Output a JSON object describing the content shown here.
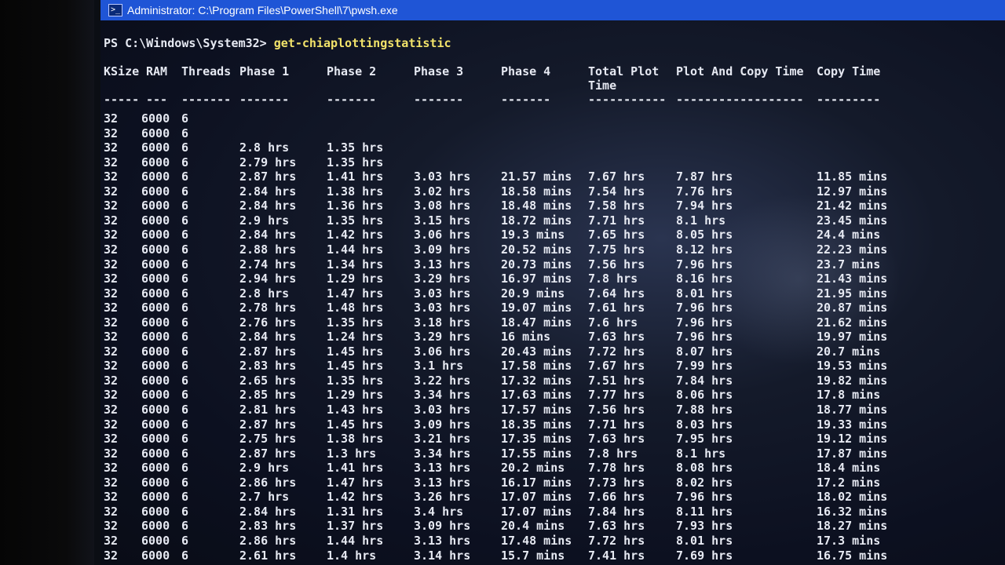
{
  "window": {
    "title": "Administrator: C:\\Program Files\\PowerShell\\7\\pwsh.exe",
    "icon": "powershell-icon"
  },
  "prompt": {
    "path": "PS C:\\Windows\\System32> ",
    "command": "get-chiaplottingstatistic"
  },
  "headers": {
    "ksize": "KSize",
    "ram": "RAM",
    "threads": "Threads",
    "phase1": "Phase 1",
    "phase2": "Phase 2",
    "phase3": "Phase 3",
    "phase4": "Phase 4",
    "total_line1": "Total Plot",
    "total_line2": "Time",
    "plot_and_copy": "Plot And Copy Time",
    "copy": "Copy Time"
  },
  "dashes": {
    "ksize": "-----",
    "ram": "---",
    "threads": "-------",
    "phase1": "-------",
    "phase2": "-------",
    "phase3": "-------",
    "phase4": "-------",
    "total": "-----------",
    "plot_and_copy": "------------------",
    "copy": "---------"
  },
  "rows": [
    [
      "32",
      "6000",
      "6",
      "",
      "",
      "",
      "",
      "",
      "",
      ""
    ],
    [
      "32",
      "6000",
      "6",
      "",
      "",
      "",
      "",
      "",
      "",
      ""
    ],
    [
      "32",
      "6000",
      "6",
      "2.8 hrs",
      "1.35 hrs",
      "",
      "",
      "",
      "",
      ""
    ],
    [
      "32",
      "6000",
      "6",
      "2.79 hrs",
      "1.35 hrs",
      "",
      "",
      "",
      "",
      ""
    ],
    [
      "32",
      "6000",
      "6",
      "2.87 hrs",
      "1.41 hrs",
      "3.03 hrs",
      "21.57 mins",
      "7.67 hrs",
      "7.87 hrs",
      "11.85 mins"
    ],
    [
      "32",
      "6000",
      "6",
      "2.84 hrs",
      "1.38 hrs",
      "3.02 hrs",
      "18.58 mins",
      "7.54 hrs",
      "7.76 hrs",
      "12.97 mins"
    ],
    [
      "32",
      "6000",
      "6",
      "2.84 hrs",
      "1.36 hrs",
      "3.08 hrs",
      "18.48 mins",
      "7.58 hrs",
      "7.94 hrs",
      "21.42 mins"
    ],
    [
      "32",
      "6000",
      "6",
      "2.9 hrs",
      "1.35 hrs",
      "3.15 hrs",
      "18.72 mins",
      "7.71 hrs",
      "8.1 hrs",
      "23.45 mins"
    ],
    [
      "32",
      "6000",
      "6",
      "2.84 hrs",
      "1.42 hrs",
      "3.06 hrs",
      "19.3 mins",
      "7.65 hrs",
      "8.05 hrs",
      "24.4 mins"
    ],
    [
      "32",
      "6000",
      "6",
      "2.88 hrs",
      "1.44 hrs",
      "3.09 hrs",
      "20.52 mins",
      "7.75 hrs",
      "8.12 hrs",
      "22.23 mins"
    ],
    [
      "32",
      "6000",
      "6",
      "2.74 hrs",
      "1.34 hrs",
      "3.13 hrs",
      "20.73 mins",
      "7.56 hrs",
      "7.96 hrs",
      "23.7 mins"
    ],
    [
      "32",
      "6000",
      "6",
      "2.94 hrs",
      "1.29 hrs",
      "3.29 hrs",
      "16.97 mins",
      "7.8 hrs",
      "8.16 hrs",
      "21.43 mins"
    ],
    [
      "32",
      "6000",
      "6",
      "2.8 hrs",
      "1.47 hrs",
      "3.03 hrs",
      "20.9 mins",
      "7.64 hrs",
      "8.01 hrs",
      "21.95 mins"
    ],
    [
      "32",
      "6000",
      "6",
      "2.78 hrs",
      "1.48 hrs",
      "3.03 hrs",
      "19.07 mins",
      "7.61 hrs",
      "7.96 hrs",
      "20.87 mins"
    ],
    [
      "32",
      "6000",
      "6",
      "2.76 hrs",
      "1.35 hrs",
      "3.18 hrs",
      "18.47 mins",
      "7.6 hrs",
      "7.96 hrs",
      "21.62 mins"
    ],
    [
      "32",
      "6000",
      "6",
      "2.84 hrs",
      "1.24 hrs",
      "3.29 hrs",
      "16 mins",
      "7.63 hrs",
      "7.96 hrs",
      "19.97 mins"
    ],
    [
      "32",
      "6000",
      "6",
      "2.87 hrs",
      "1.45 hrs",
      "3.06 hrs",
      "20.43 mins",
      "7.72 hrs",
      "8.07 hrs",
      "20.7 mins"
    ],
    [
      "32",
      "6000",
      "6",
      "2.83 hrs",
      "1.45 hrs",
      "3.1 hrs",
      "17.58 mins",
      "7.67 hrs",
      "7.99 hrs",
      "19.53 mins"
    ],
    [
      "32",
      "6000",
      "6",
      "2.65 hrs",
      "1.35 hrs",
      "3.22 hrs",
      "17.32 mins",
      "7.51 hrs",
      "7.84 hrs",
      "19.82 mins"
    ],
    [
      "32",
      "6000",
      "6",
      "2.85 hrs",
      "1.29 hrs",
      "3.34 hrs",
      "17.63 mins",
      "7.77 hrs",
      "8.06 hrs",
      "17.8 mins"
    ],
    [
      "32",
      "6000",
      "6",
      "2.81 hrs",
      "1.43 hrs",
      "3.03 hrs",
      "17.57 mins",
      "7.56 hrs",
      "7.88 hrs",
      "18.77 mins"
    ],
    [
      "32",
      "6000",
      "6",
      "2.87 hrs",
      "1.45 hrs",
      "3.09 hrs",
      "18.35 mins",
      "7.71 hrs",
      "8.03 hrs",
      "19.33 mins"
    ],
    [
      "32",
      "6000",
      "6",
      "2.75 hrs",
      "1.38 hrs",
      "3.21 hrs",
      "17.35 mins",
      "7.63 hrs",
      "7.95 hrs",
      "19.12 mins"
    ],
    [
      "32",
      "6000",
      "6",
      "2.87 hrs",
      "1.3 hrs",
      "3.34 hrs",
      "17.55 mins",
      "7.8 hrs",
      "8.1 hrs",
      "17.87 mins"
    ],
    [
      "32",
      "6000",
      "6",
      "2.9 hrs",
      "1.41 hrs",
      "3.13 hrs",
      "20.2 mins",
      "7.78 hrs",
      "8.08 hrs",
      "18.4 mins"
    ],
    [
      "32",
      "6000",
      "6",
      "2.86 hrs",
      "1.47 hrs",
      "3.13 hrs",
      "16.17 mins",
      "7.73 hrs",
      "8.02 hrs",
      "17.2 mins"
    ],
    [
      "32",
      "6000",
      "6",
      "2.7 hrs",
      "1.42 hrs",
      "3.26 hrs",
      "17.07 mins",
      "7.66 hrs",
      "7.96 hrs",
      "18.02 mins"
    ],
    [
      "32",
      "6000",
      "6",
      "2.84 hrs",
      "1.31 hrs",
      "3.4 hrs",
      "17.07 mins",
      "7.84 hrs",
      "8.11 hrs",
      "16.32 mins"
    ],
    [
      "32",
      "6000",
      "6",
      "2.83 hrs",
      "1.37 hrs",
      "3.09 hrs",
      "20.4 mins",
      "7.63 hrs",
      "7.93 hrs",
      "18.27 mins"
    ],
    [
      "32",
      "6000",
      "6",
      "2.86 hrs",
      "1.44 hrs",
      "3.13 hrs",
      "17.48 mins",
      "7.72 hrs",
      "8.01 hrs",
      "17.3 mins"
    ],
    [
      "32",
      "6000",
      "6",
      "2.61 hrs",
      "1.4 hrs",
      "3.14 hrs",
      "15.7 mins",
      "7.41 hrs",
      "7.69 hrs",
      "16.75 mins"
    ]
  ],
  "colors": {
    "titlebar": "#1f55d6",
    "command": "#f2e36a",
    "text": "#e6e9f2"
  }
}
